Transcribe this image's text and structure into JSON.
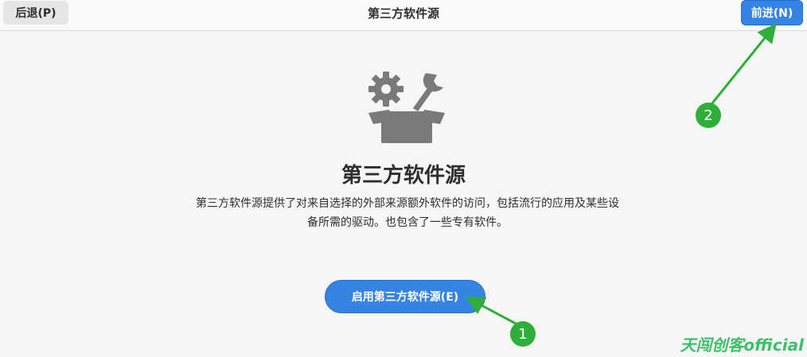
{
  "header": {
    "back_label": "后退(P)",
    "title": "第三方软件源",
    "next_label": "前进(N)"
  },
  "main": {
    "icon": "box-with-gear-and-wrench-icon",
    "title": "第三方软件源",
    "description_line1": "第三方软件源提供了对来自选择的外部来源额外软件的访问，包括流行的应用及某些设",
    "description_line2": "备所需的驱动。也包含了一些专有软件。",
    "enable_button_label": "启用第三方软件源(E)"
  },
  "annotations": {
    "marker_1": "1",
    "marker_2": "2",
    "color": "#2fae3a"
  },
  "watermark": "天闯创客official",
  "colors": {
    "accent": "#3584e4",
    "background": "#f6f6f6",
    "icon_gray": "#7a7a7a"
  }
}
